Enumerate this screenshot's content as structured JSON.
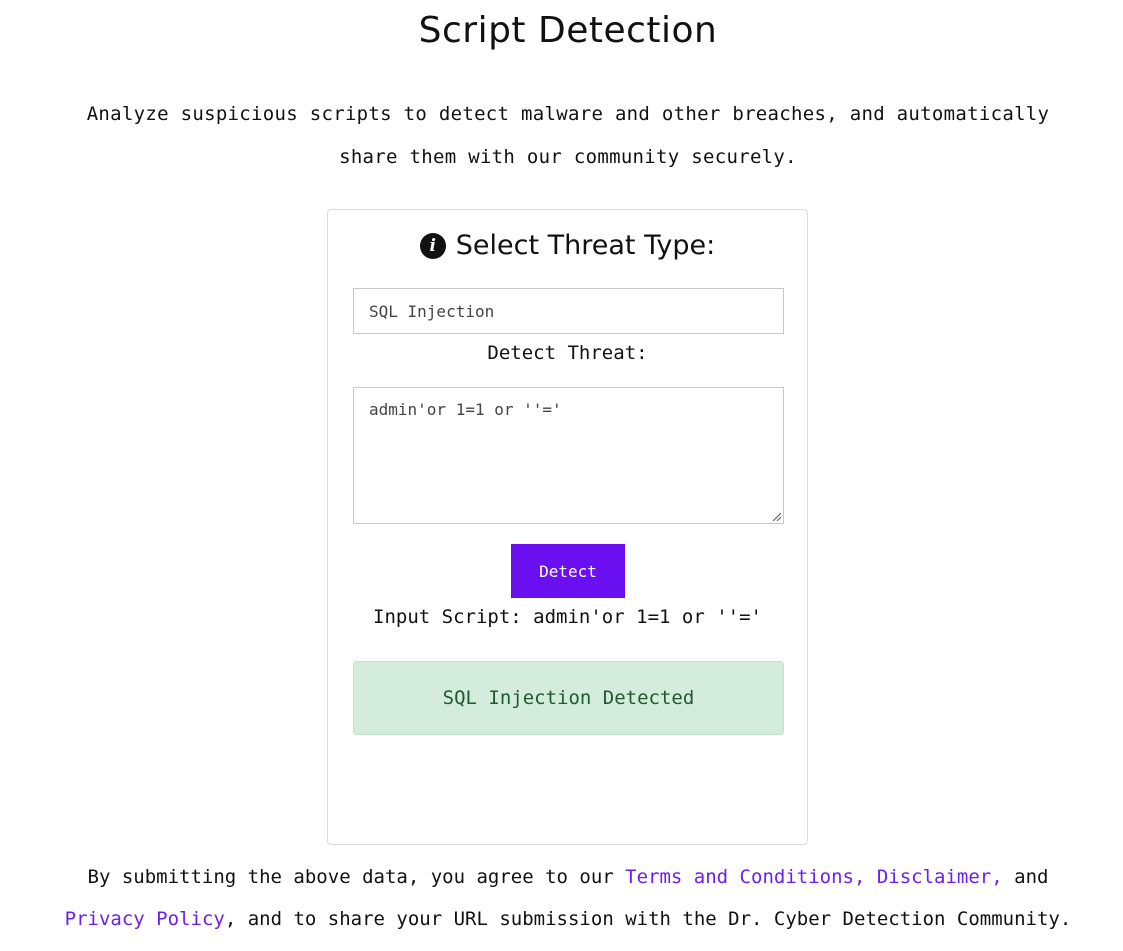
{
  "page": {
    "title": "Script Detection",
    "subtitle": "Analyze suspicious scripts to detect malware and other breaches, and automatically share them with our community securely."
  },
  "card": {
    "header_title": "Select Threat Type:",
    "threat_type_value": "SQL Injection",
    "detect_label": "Detect Threat:",
    "script_value": "admin'or 1=1 or ''='",
    "detect_button_label": "Detect",
    "input_script_line": "Input Script: admin'or 1=1 or ''='",
    "result_text": "SQL Injection Detected"
  },
  "footer": {
    "text_before": "By submitting the above data, you agree to our ",
    "terms_link": "Terms and Conditions,",
    "space": " ",
    "disclaimer_link": "Disclaimer,",
    "text_and": " and ",
    "privacy_link": "Privacy Policy",
    "text_after": ", and to share your URL submission with the Dr. Cyber Detection Community."
  },
  "colors": {
    "primary_button": "#6a0ff0",
    "link": "#6a1ff0",
    "success_bg": "#d4ecdb",
    "success_text": "#1f5a31"
  },
  "icons": {
    "header_icon": "info-circle-icon",
    "textarea_icon": "resize-handle-icon"
  }
}
